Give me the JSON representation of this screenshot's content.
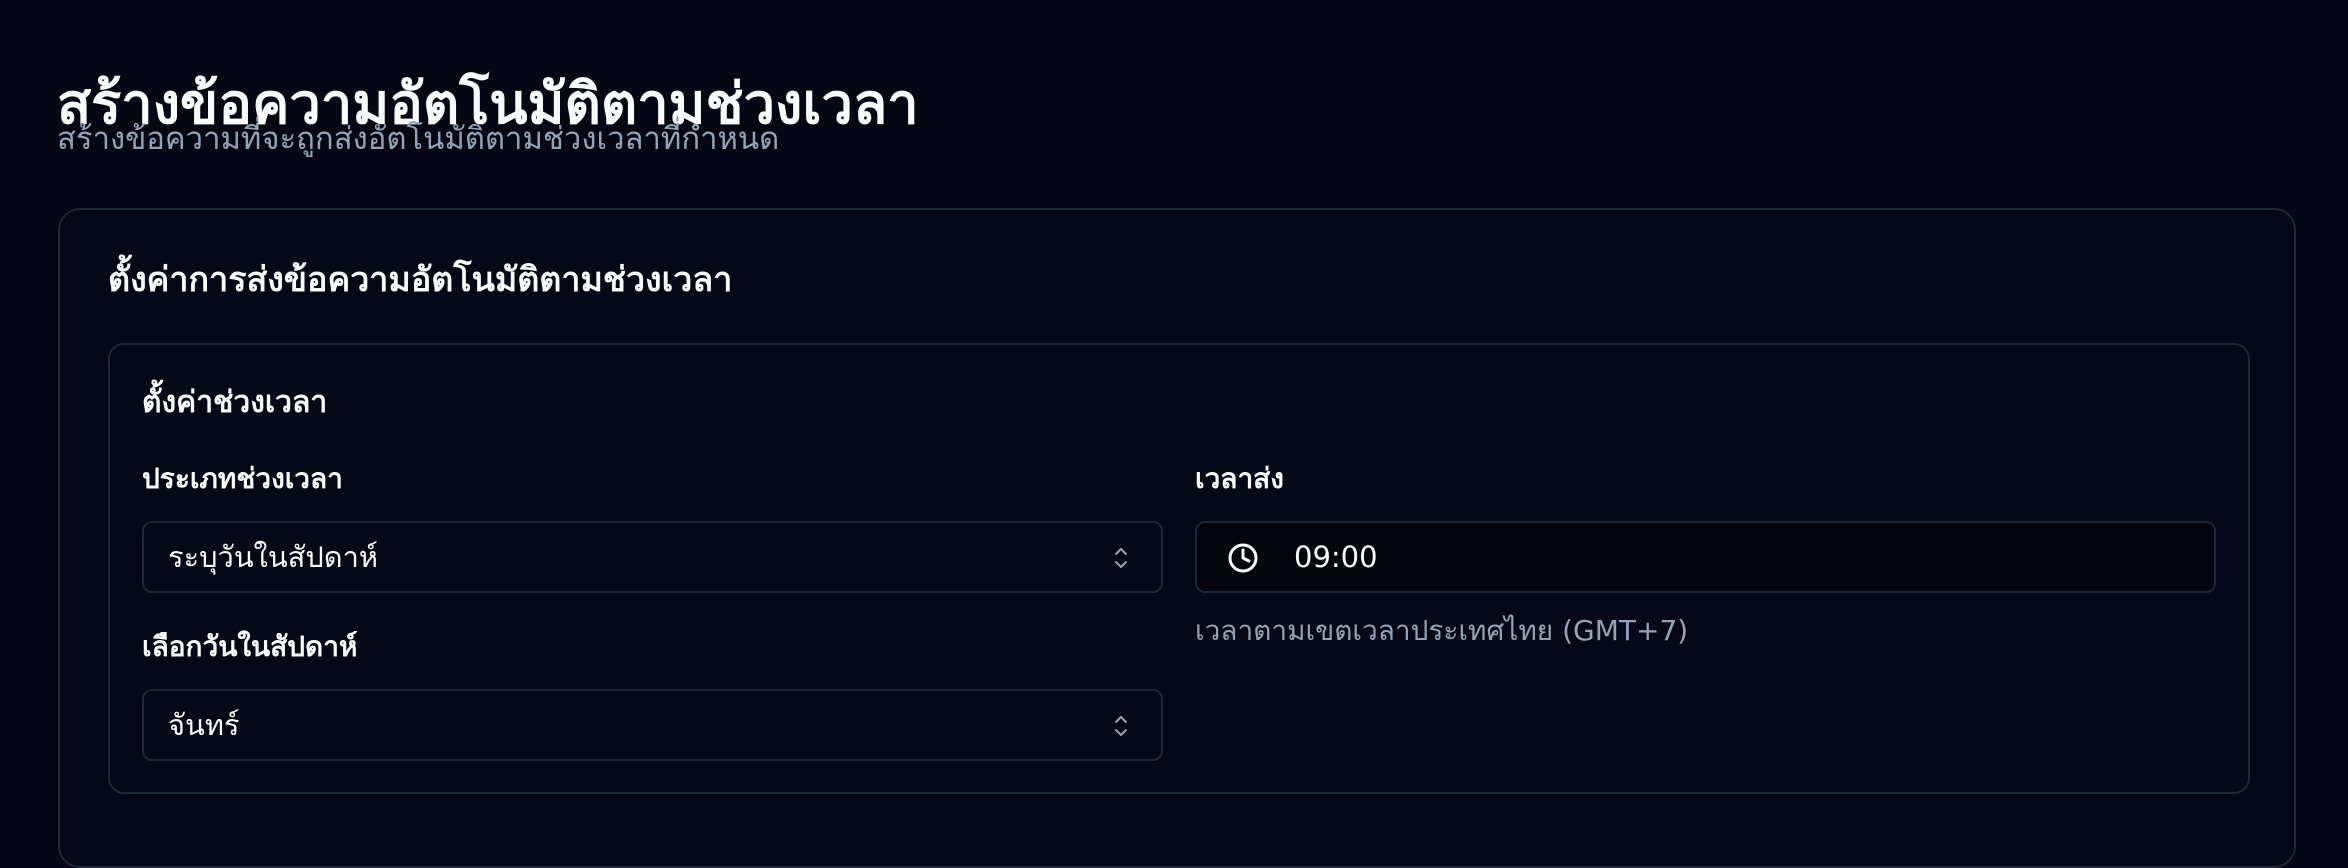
{
  "page": {
    "title": "สร้างข้อความอัตโนมัติตามช่วงเวลา",
    "subtitle": "สร้างข้อความที่จะถูกส่งอัตโนมัติตามช่วงเวลาที่กำหนด"
  },
  "settings_card": {
    "title": "ตั้งค่าการส่งข้อความอัตโนมัติตามช่วงเวลา",
    "time_range_section": {
      "title": "ตั้งค่าช่วงเวลา",
      "range_type": {
        "label": "ประเภทช่วงเวลา",
        "selected_value": "ระบุวันในสัปดาห์",
        "icon": "chevron-up-down-icon"
      },
      "day_of_week": {
        "label": "เลือกวันในสัปดาห์",
        "selected_value": "จันทร์",
        "icon": "chevron-up-down-icon"
      },
      "send_time": {
        "label": "เวลาส่ง",
        "value": "09:00",
        "icon": "clock-icon",
        "helper_text": "เวลาตามเขตเวลาประเทศไทย (GMT+7)"
      }
    }
  },
  "colors": {
    "background": "#050814",
    "card_border": "#1f2937",
    "text_primary": "#f8fafc",
    "text_muted": "#94a3b8"
  }
}
